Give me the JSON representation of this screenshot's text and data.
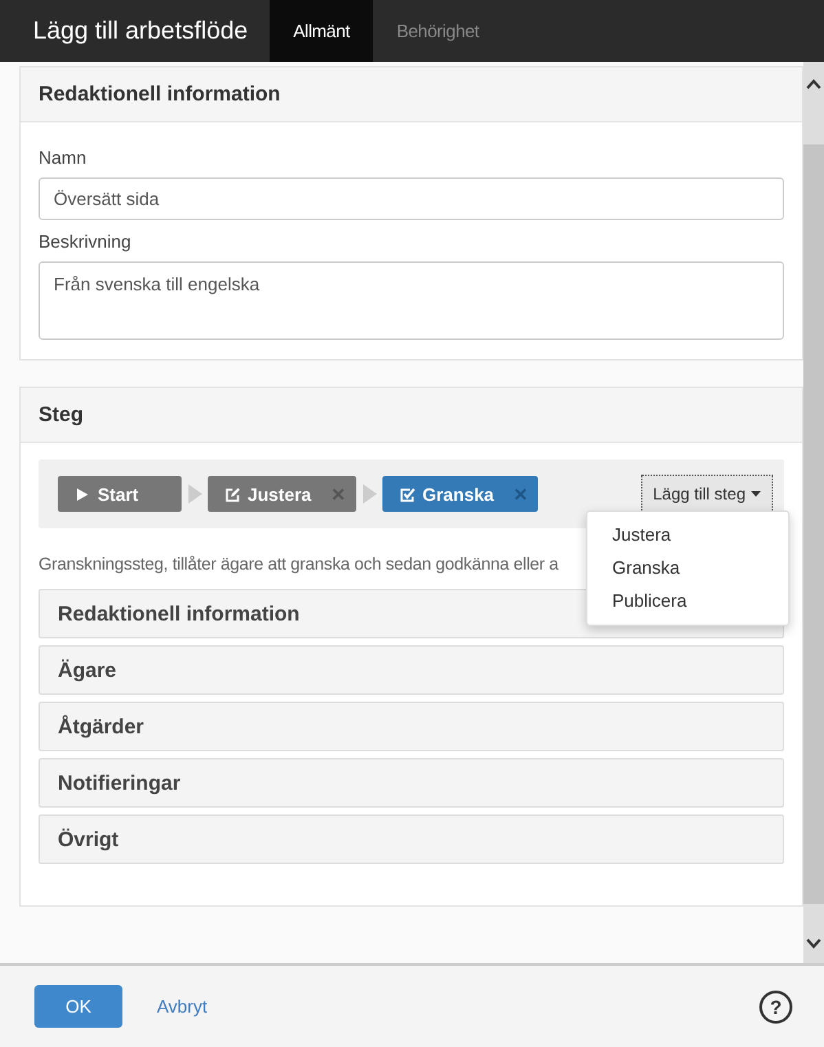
{
  "window": {
    "title": "Lägg till arbetsflöde"
  },
  "tabs": [
    {
      "label": "Allmänt",
      "selected": true
    },
    {
      "label": "Behörighet",
      "selected": false
    }
  ],
  "editorial_section": {
    "title": "Redaktionell information",
    "fields": [
      {
        "label": "Namn",
        "value": "Översätt sida",
        "kind": "input"
      },
      {
        "label": "Beskrivning",
        "value": "Från svenska till engelska",
        "kind": "textarea"
      }
    ]
  },
  "steps_section": {
    "title": "Steg",
    "steps": [
      {
        "kind": "start",
        "label": "Start",
        "selected": false,
        "removable": false
      },
      {
        "kind": "edit",
        "label": "Justera",
        "selected": false,
        "removable": true
      },
      {
        "kind": "review",
        "label": "Granska",
        "selected": true,
        "removable": true
      }
    ],
    "remove_mark": "✕",
    "add_button": "Lägg till steg",
    "add_menu": [
      "Justera",
      "Granska",
      "Publicera"
    ],
    "description": "Granskningssteg, tillåter ägare att granska och sedan godkänna eller a",
    "accordions": [
      {
        "title": "Redaktionell information",
        "expanded": false
      },
      {
        "title": "Ägare",
        "expanded": false
      },
      {
        "title": "Åtgärder",
        "expanded": false
      },
      {
        "title": "Notifieringar",
        "expanded": false
      },
      {
        "title": "Övrigt",
        "expanded": false
      }
    ]
  },
  "footer": {
    "ok": "OK",
    "cancel": "Avbryt",
    "help": "?"
  }
}
